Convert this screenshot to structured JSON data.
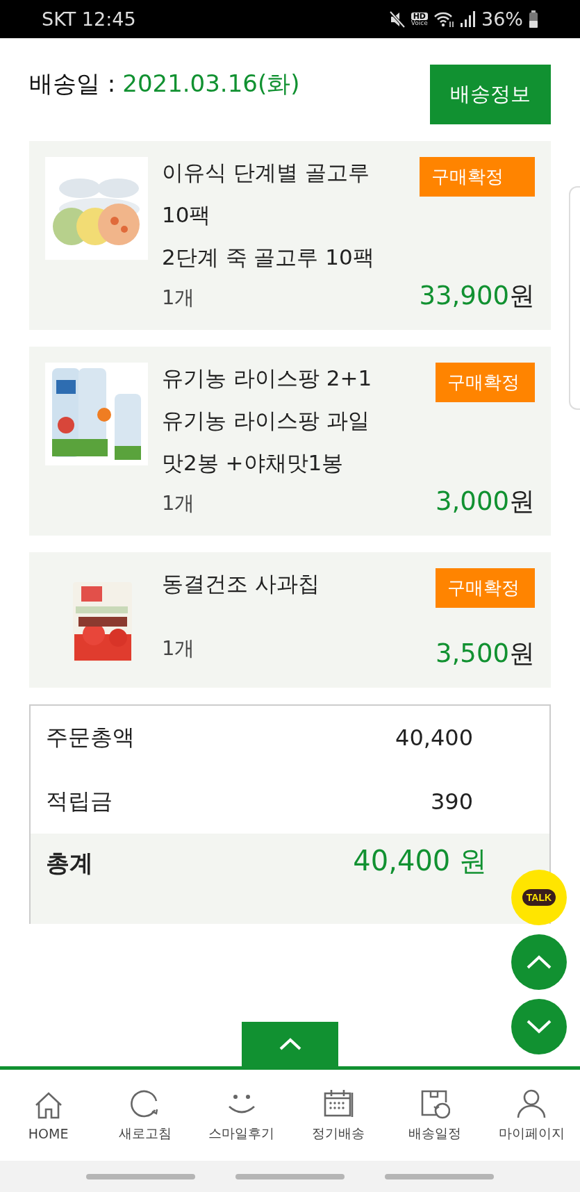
{
  "status_bar": {
    "carrier_time": "SKT 12:45",
    "hd_label": "HD",
    "voice_label": "Voice",
    "battery": "36%"
  },
  "header": {
    "label": "배송일 :",
    "date": "2021.03.16(화)",
    "button": "배송정보"
  },
  "products": [
    {
      "name": "이유식 단계별 골고루 10팩",
      "option": "2단계 죽 골고루 10팩",
      "badge": "구매확정",
      "quantity": "1개",
      "price": "33,900",
      "currency": "원"
    },
    {
      "name": "유기농 라이스팡 2+1",
      "option": "유기농 라이스팡 과일맛2봉 +야채맛1봉",
      "badge": "구매확정",
      "quantity": "1개",
      "price": "3,000",
      "currency": "원"
    },
    {
      "name": "동결건조 사과칩",
      "badge": "구매확정",
      "quantity": "1개",
      "price": "3,500",
      "currency": "원"
    }
  ],
  "summary": {
    "rows": [
      {
        "label": "주문총액",
        "value": "40,400"
      },
      {
        "label": "적립금",
        "value": "390"
      }
    ],
    "total": {
      "label": "총계",
      "value": "40,400 원"
    }
  },
  "floating": {
    "talk_label": "TALK"
  },
  "nav": [
    {
      "label": "HOME",
      "kind": "home"
    },
    {
      "label": "새로고침",
      "kind": "refresh"
    },
    {
      "label": "스마일후기",
      "kind": "smile"
    },
    {
      "label": "정기배송",
      "kind": "calendar"
    },
    {
      "label": "배송일정",
      "kind": "box"
    },
    {
      "label": "마이페이지",
      "kind": "person"
    }
  ]
}
